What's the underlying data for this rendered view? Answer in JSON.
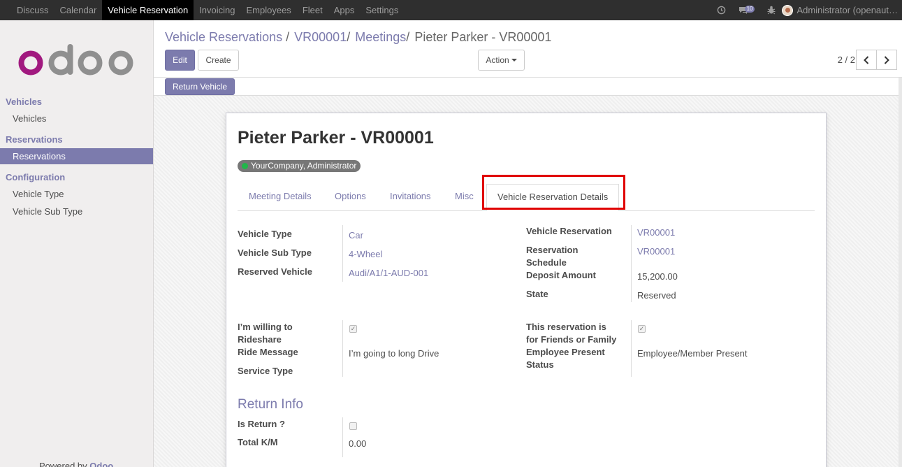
{
  "topbar": {
    "menu": [
      "Discuss",
      "Calendar",
      "Vehicle Reservation",
      "Invoicing",
      "Employees",
      "Fleet",
      "Apps",
      "Settings"
    ],
    "active_index": 2,
    "message_count": "10",
    "user": "Administrator (openaut…"
  },
  "sidebar": {
    "logo_text": "odoo",
    "sections": [
      {
        "title": "Vehicles",
        "items": [
          "Vehicles"
        ]
      },
      {
        "title": "Reservations",
        "items": [
          "Reservations"
        ]
      },
      {
        "title": "Configuration",
        "items": [
          "Vehicle Type",
          "Vehicle Sub Type"
        ]
      }
    ],
    "active_item": "Reservations",
    "powered_prefix": "Powered by ",
    "powered_brand": "Odoo"
  },
  "control_panel": {
    "breadcrumb": [
      "Vehicle Reservations",
      "VR00001",
      "Meetings"
    ],
    "breadcrumb_current": "Pieter Parker - VR00001",
    "edit_label": "Edit",
    "create_label": "Create",
    "action_label": "Action",
    "pager": "2 / 2"
  },
  "statusbar": {
    "return_vehicle_label": "Return Vehicle"
  },
  "form": {
    "title": "Pieter Parker - VR00001",
    "tag": "YourCompany, Administrator",
    "tabs": [
      "Meeting Details",
      "Options",
      "Invitations",
      "Misc",
      "Vehicle Reservation Details"
    ],
    "active_tab": "Vehicle Reservation Details",
    "left": {
      "vehicle_type_label": "Vehicle Type",
      "vehicle_type": "Car",
      "vehicle_sub_type_label": "Vehicle Sub Type",
      "vehicle_sub_type": "4-Wheel",
      "reserved_vehicle_label": "Reserved Vehicle",
      "reserved_vehicle": "Audi/A1/1-AUD-001",
      "rideshare_label_1": "I’m willing to",
      "rideshare_label_2": "Rideshare",
      "rideshare_checked": true,
      "ride_message_label": "Ride Message",
      "ride_message": "I’m going to long Drive",
      "service_type_label": "Service Type"
    },
    "right": {
      "vehicle_reservation_label": "Vehicle Reservation",
      "vehicle_reservation": "VR00001",
      "reservation_schedule_label_1": "Reservation",
      "reservation_schedule_label_2": "Schedule",
      "reservation_schedule": "VR00001",
      "deposit_amount_label": "Deposit Amount",
      "deposit_amount": "15,200.00",
      "state_label": "State",
      "state": "Reserved",
      "friends_label_1": "This reservation is",
      "friends_label_2": "for Friends or Family",
      "friends_checked": true,
      "employee_present_label_1": "Employee Present",
      "employee_present_label_2": "Status",
      "employee_present": "Employee/Member Present"
    },
    "return_info": {
      "heading": "Return Info",
      "is_return_label": "Is Return ?",
      "is_return_checked": false,
      "total_km_label": "Total K/M",
      "total_km": "0.00"
    }
  }
}
